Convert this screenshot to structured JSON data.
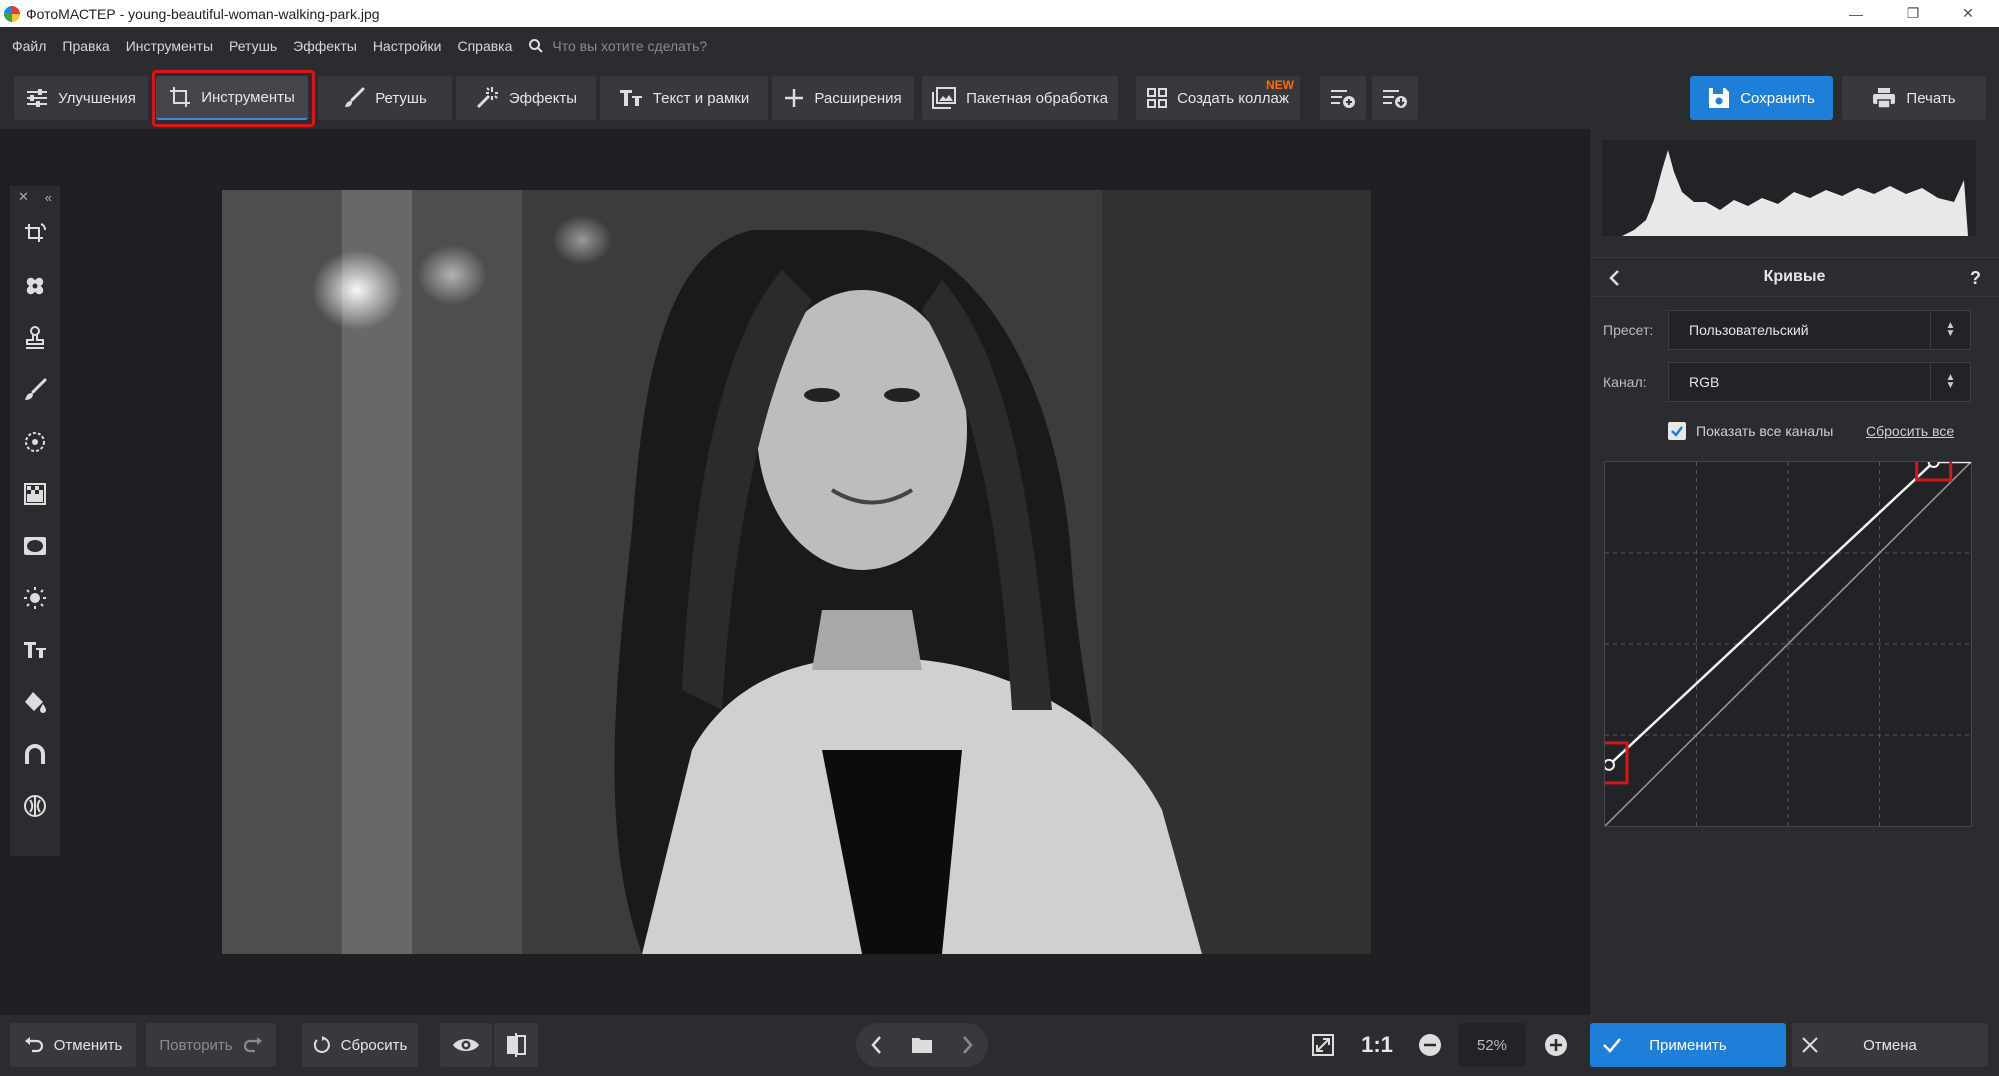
{
  "window": {
    "title": "ФотоМАСТЕР - young-beautiful-woman-walking-park.jpg"
  },
  "menu": {
    "items": [
      "Файл",
      "Правка",
      "Инструменты",
      "Ретушь",
      "Эффекты",
      "Настройки",
      "Справка"
    ],
    "search_placeholder": "Что вы хотите сделать?"
  },
  "toolbar": {
    "enhancements": "Улучшения",
    "tools": "Инструменты",
    "retouch": "Ретушь",
    "effects": "Эффекты",
    "text_frames": "Текст и рамки",
    "extensions": "Расширения",
    "batch": "Пакетная обработка",
    "collage": "Создать коллаж",
    "collage_badge": "NEW",
    "save": "Сохранить",
    "print": "Печать"
  },
  "panel": {
    "title": "Кривые",
    "help": "?",
    "preset_label": "Пресет:",
    "preset_value": "Пользовательский",
    "channel_label": "Канал:",
    "channel_value": "RGB",
    "show_all_channels": "Показать все каналы",
    "show_all_checked": true,
    "reset_all": "Сбросить все",
    "curve_points": [
      [
        0,
        40
      ],
      [
        229,
        255
      ]
    ]
  },
  "bottom": {
    "undo": "Отменить",
    "redo": "Повторить",
    "reset": "Сбросить",
    "ratio": "1:1",
    "zoom": "52%",
    "apply": "Применить",
    "cancel": "Отмена"
  },
  "colors": {
    "accent": "#1f7fd8",
    "highlight": "#d9141b",
    "badge": "#ff6a00"
  }
}
